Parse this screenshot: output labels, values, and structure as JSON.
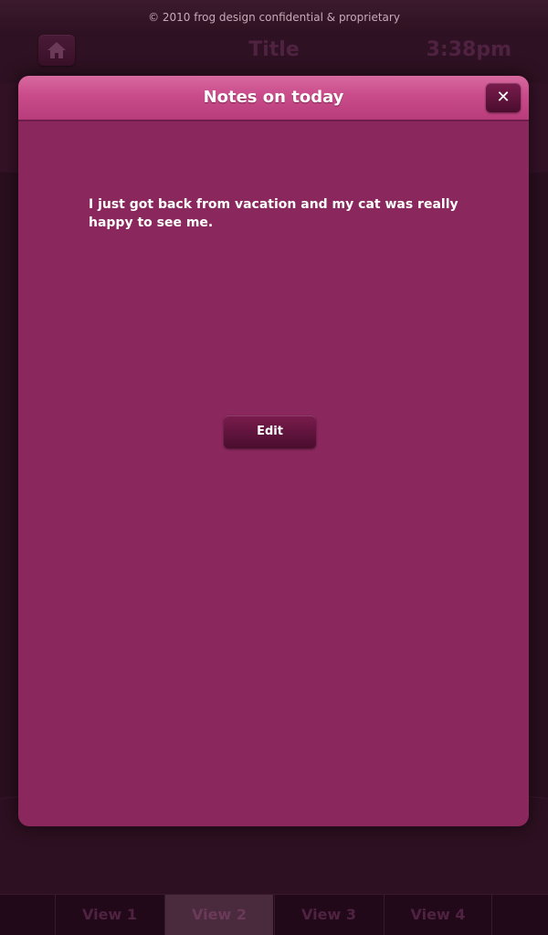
{
  "status_bar": {
    "copyright": "© 2010 frog design confidential & proprietary"
  },
  "header": {
    "title": "Title",
    "time": "3:38pm",
    "home_icon": "home-icon"
  },
  "modal": {
    "title": "Notes on today",
    "close_label": "✕",
    "note": "I just got back from vacation and my cat was really happy to see me.",
    "edit_label": "Edit"
  },
  "tabs": [
    {
      "label": "View 1",
      "active": false
    },
    {
      "label": "View 2",
      "active": true
    },
    {
      "label": "View 3",
      "active": false
    },
    {
      "label": "View 4",
      "active": false
    }
  ],
  "colors": {
    "modal_header": "#c94b8a",
    "modal_body": "#8a275c",
    "background": "#2e1122",
    "button": "#5e1439"
  }
}
